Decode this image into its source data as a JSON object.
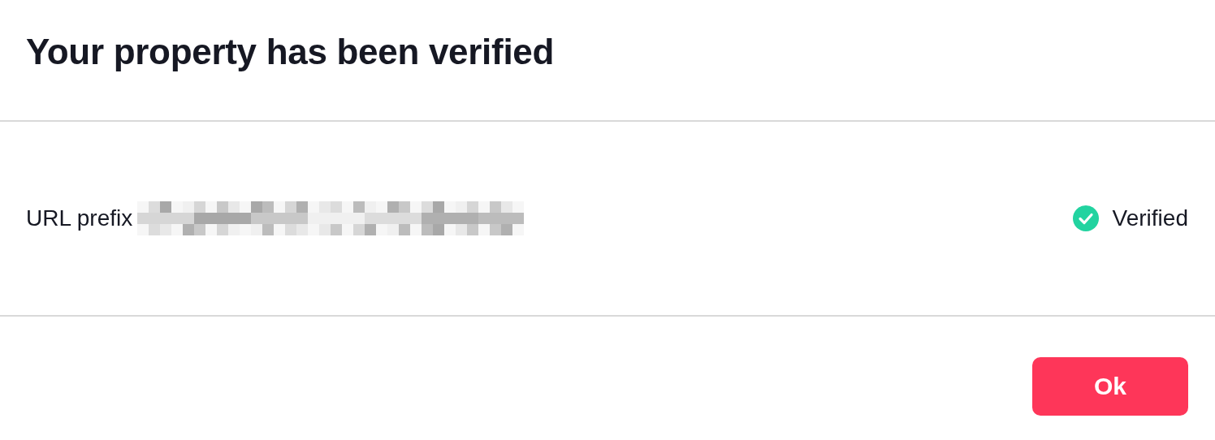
{
  "dialog": {
    "title": "Your property has been verified",
    "property": {
      "label": "URL prefix",
      "status": "Verified",
      "verified": true
    },
    "buttons": [
      {
        "label": "Ok",
        "kind": "primary"
      }
    ]
  }
}
